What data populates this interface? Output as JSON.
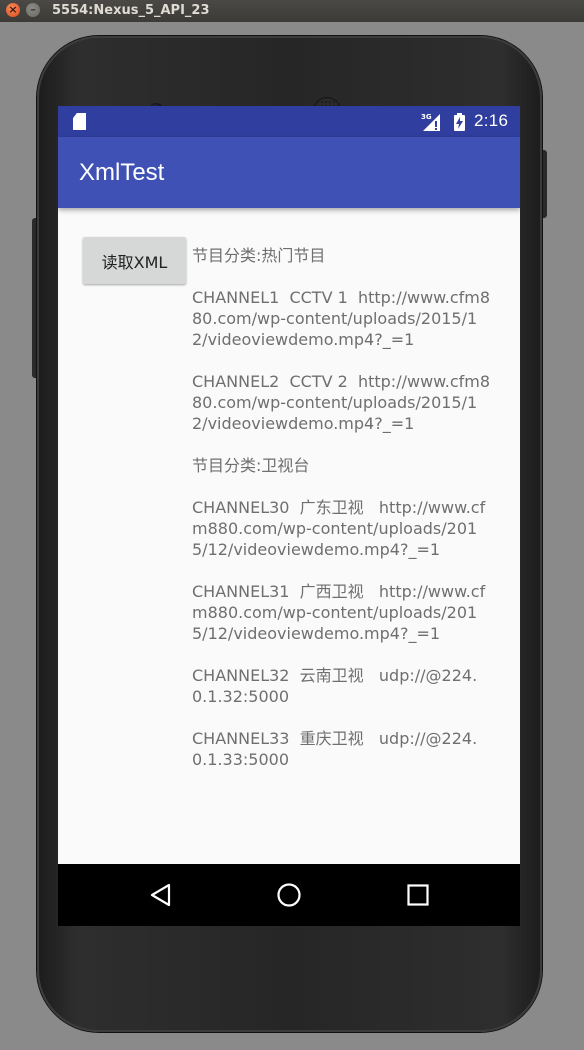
{
  "window": {
    "title": "5554:Nexus_5_API_23",
    "close_glyph": "×",
    "minimize_glyph": "–"
  },
  "status_bar": {
    "network": "3G",
    "time": "2:16",
    "icons": [
      "sd-card-icon",
      "signal-icon",
      "battery-icon"
    ]
  },
  "app_bar": {
    "title": "XmlTest"
  },
  "main": {
    "read_button_label": "读取XML",
    "output_text": "节目分类:热门节目\n\nCHANNEL1  CCTV 1  http://www.cfm880.com/wp-content/uploads/2015/12/videoviewdemo.mp4?_=1\n\nCHANNEL2  CCTV 2  http://www.cfm880.com/wp-content/uploads/2015/12/videoviewdemo.mp4?_=1\n\n节目分类:卫视台\n\nCHANNEL30  广东卫视   http://www.cfm880.com/wp-content/uploads/2015/12/videoviewdemo.mp4?_=1\n\nCHANNEL31  广西卫视   http://www.cfm880.com/wp-content/uploads/2015/12/videoviewdemo.mp4?_=1\n\nCHANNEL32  云南卫视   udp://@224.0.1.32:5000\n\nCHANNEL33  重庆卫视   udp://@224.0.1.33:5000"
  },
  "nav_bar": {
    "icons": [
      "back-icon",
      "home-icon",
      "recents-icon"
    ]
  },
  "colors": {
    "status_bar": "#303f9f",
    "app_bar": "#3f51b5",
    "background": "#fafafa",
    "text": "#6f6f6f",
    "button": "#d6d7d7"
  }
}
